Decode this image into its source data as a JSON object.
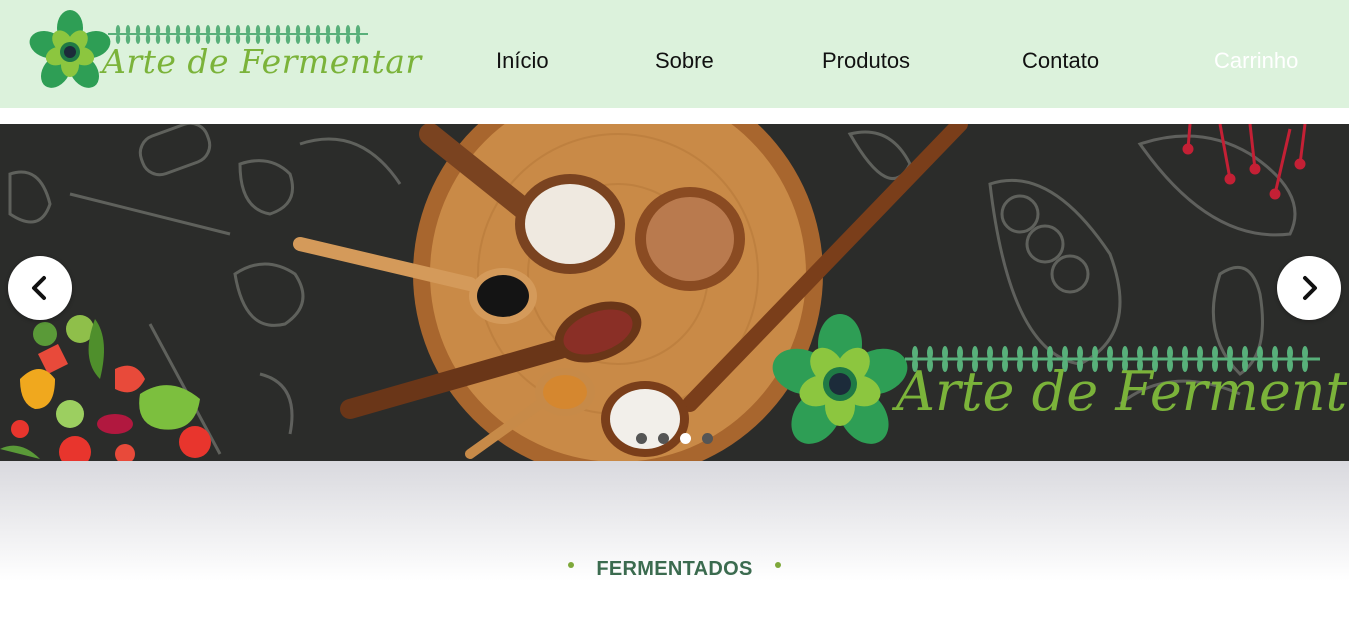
{
  "brand": {
    "name": "Arte de Fermentar"
  },
  "nav": {
    "items": [
      "Início",
      "Sobre",
      "Produtos",
      "Contato"
    ],
    "cart_label": "Carrinho"
  },
  "carousel": {
    "banner_text": "Arte de Fermentar",
    "slide_count": 4,
    "active_slide": 3,
    "prev_icon": "chevron-left-icon",
    "next_icon": "chevron-right-icon"
  },
  "section": {
    "title": "FERMENTADOS"
  },
  "colors": {
    "header_bg": "#dcf2dc",
    "brand_green": "#7bb33a",
    "leaf_green": "#2e9e55",
    "section_title": "#3b6b4f"
  }
}
